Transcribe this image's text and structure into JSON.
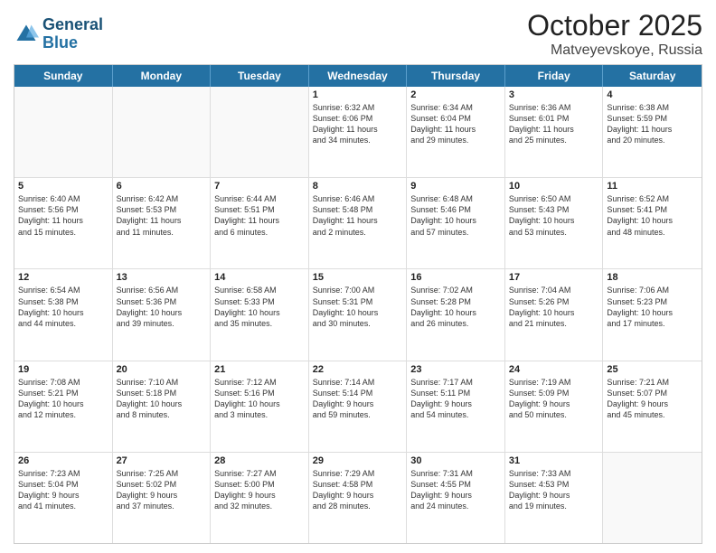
{
  "logo": {
    "line1": "General",
    "line2": "Blue"
  },
  "title": "October 2025",
  "subtitle": "Matveyevskoye, Russia",
  "days": [
    "Sunday",
    "Monday",
    "Tuesday",
    "Wednesday",
    "Thursday",
    "Friday",
    "Saturday"
  ],
  "rows": [
    [
      {
        "day": "",
        "info": ""
      },
      {
        "day": "",
        "info": ""
      },
      {
        "day": "",
        "info": ""
      },
      {
        "day": "1",
        "info": "Sunrise: 6:32 AM\nSunset: 6:06 PM\nDaylight: 11 hours\nand 34 minutes."
      },
      {
        "day": "2",
        "info": "Sunrise: 6:34 AM\nSunset: 6:04 PM\nDaylight: 11 hours\nand 29 minutes."
      },
      {
        "day": "3",
        "info": "Sunrise: 6:36 AM\nSunset: 6:01 PM\nDaylight: 11 hours\nand 25 minutes."
      },
      {
        "day": "4",
        "info": "Sunrise: 6:38 AM\nSunset: 5:59 PM\nDaylight: 11 hours\nand 20 minutes."
      }
    ],
    [
      {
        "day": "5",
        "info": "Sunrise: 6:40 AM\nSunset: 5:56 PM\nDaylight: 11 hours\nand 15 minutes."
      },
      {
        "day": "6",
        "info": "Sunrise: 6:42 AM\nSunset: 5:53 PM\nDaylight: 11 hours\nand 11 minutes."
      },
      {
        "day": "7",
        "info": "Sunrise: 6:44 AM\nSunset: 5:51 PM\nDaylight: 11 hours\nand 6 minutes."
      },
      {
        "day": "8",
        "info": "Sunrise: 6:46 AM\nSunset: 5:48 PM\nDaylight: 11 hours\nand 2 minutes."
      },
      {
        "day": "9",
        "info": "Sunrise: 6:48 AM\nSunset: 5:46 PM\nDaylight: 10 hours\nand 57 minutes."
      },
      {
        "day": "10",
        "info": "Sunrise: 6:50 AM\nSunset: 5:43 PM\nDaylight: 10 hours\nand 53 minutes."
      },
      {
        "day": "11",
        "info": "Sunrise: 6:52 AM\nSunset: 5:41 PM\nDaylight: 10 hours\nand 48 minutes."
      }
    ],
    [
      {
        "day": "12",
        "info": "Sunrise: 6:54 AM\nSunset: 5:38 PM\nDaylight: 10 hours\nand 44 minutes."
      },
      {
        "day": "13",
        "info": "Sunrise: 6:56 AM\nSunset: 5:36 PM\nDaylight: 10 hours\nand 39 minutes."
      },
      {
        "day": "14",
        "info": "Sunrise: 6:58 AM\nSunset: 5:33 PM\nDaylight: 10 hours\nand 35 minutes."
      },
      {
        "day": "15",
        "info": "Sunrise: 7:00 AM\nSunset: 5:31 PM\nDaylight: 10 hours\nand 30 minutes."
      },
      {
        "day": "16",
        "info": "Sunrise: 7:02 AM\nSunset: 5:28 PM\nDaylight: 10 hours\nand 26 minutes."
      },
      {
        "day": "17",
        "info": "Sunrise: 7:04 AM\nSunset: 5:26 PM\nDaylight: 10 hours\nand 21 minutes."
      },
      {
        "day": "18",
        "info": "Sunrise: 7:06 AM\nSunset: 5:23 PM\nDaylight: 10 hours\nand 17 minutes."
      }
    ],
    [
      {
        "day": "19",
        "info": "Sunrise: 7:08 AM\nSunset: 5:21 PM\nDaylight: 10 hours\nand 12 minutes."
      },
      {
        "day": "20",
        "info": "Sunrise: 7:10 AM\nSunset: 5:18 PM\nDaylight: 10 hours\nand 8 minutes."
      },
      {
        "day": "21",
        "info": "Sunrise: 7:12 AM\nSunset: 5:16 PM\nDaylight: 10 hours\nand 3 minutes."
      },
      {
        "day": "22",
        "info": "Sunrise: 7:14 AM\nSunset: 5:14 PM\nDaylight: 9 hours\nand 59 minutes."
      },
      {
        "day": "23",
        "info": "Sunrise: 7:17 AM\nSunset: 5:11 PM\nDaylight: 9 hours\nand 54 minutes."
      },
      {
        "day": "24",
        "info": "Sunrise: 7:19 AM\nSunset: 5:09 PM\nDaylight: 9 hours\nand 50 minutes."
      },
      {
        "day": "25",
        "info": "Sunrise: 7:21 AM\nSunset: 5:07 PM\nDaylight: 9 hours\nand 45 minutes."
      }
    ],
    [
      {
        "day": "26",
        "info": "Sunrise: 7:23 AM\nSunset: 5:04 PM\nDaylight: 9 hours\nand 41 minutes."
      },
      {
        "day": "27",
        "info": "Sunrise: 7:25 AM\nSunset: 5:02 PM\nDaylight: 9 hours\nand 37 minutes."
      },
      {
        "day": "28",
        "info": "Sunrise: 7:27 AM\nSunset: 5:00 PM\nDaylight: 9 hours\nand 32 minutes."
      },
      {
        "day": "29",
        "info": "Sunrise: 7:29 AM\nSunset: 4:58 PM\nDaylight: 9 hours\nand 28 minutes."
      },
      {
        "day": "30",
        "info": "Sunrise: 7:31 AM\nSunset: 4:55 PM\nDaylight: 9 hours\nand 24 minutes."
      },
      {
        "day": "31",
        "info": "Sunrise: 7:33 AM\nSunset: 4:53 PM\nDaylight: 9 hours\nand 19 minutes."
      },
      {
        "day": "",
        "info": ""
      }
    ]
  ]
}
